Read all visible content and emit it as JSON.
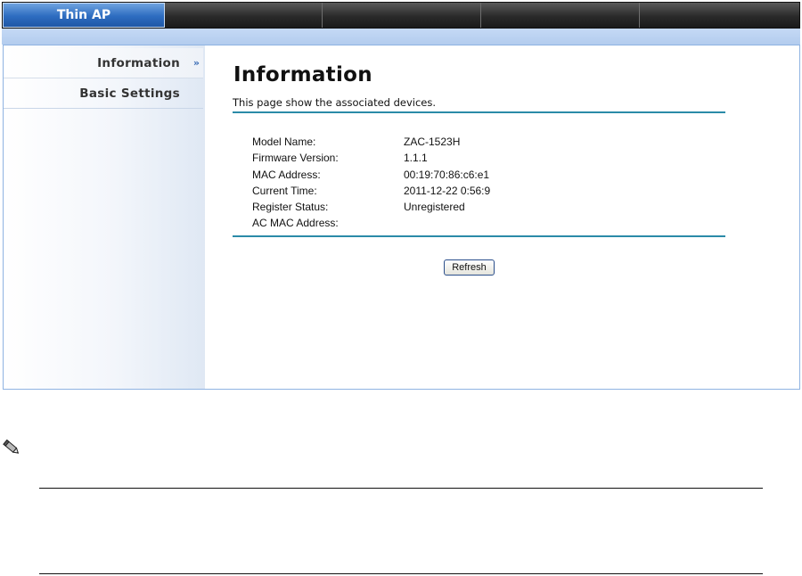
{
  "nav": {
    "tabs": [
      {
        "label": "Thin AP",
        "active": true
      },
      {
        "label": "",
        "active": false
      },
      {
        "label": "",
        "active": false
      },
      {
        "label": "",
        "active": false
      },
      {
        "label": "",
        "active": false
      }
    ]
  },
  "sidebar": {
    "items": [
      {
        "label": "Information",
        "arrow": "»"
      },
      {
        "label": "Basic Settings"
      }
    ]
  },
  "main": {
    "title": "Information",
    "description": "This page show the associated devices.",
    "rows": [
      {
        "label": "Model Name:",
        "value": "ZAC-1523H"
      },
      {
        "label": "Firmware Version:",
        "value": "1.1.1"
      },
      {
        "label": "MAC Address:",
        "value": "00:19:70:86:c6:e1"
      },
      {
        "label": "Current Time:",
        "value": "2011-12-22 0:56:9"
      },
      {
        "label": "Register Status:",
        "value": "Unregistered"
      },
      {
        "label": "AC MAC Address:",
        "value": ""
      }
    ],
    "refresh_label": "Refresh"
  },
  "colors": {
    "nav_active": "#2d6cc0",
    "accent_rule": "#2b8ba8",
    "frame_border": "#8fb3e2"
  },
  "icons": {
    "note": "pencil-icon"
  }
}
